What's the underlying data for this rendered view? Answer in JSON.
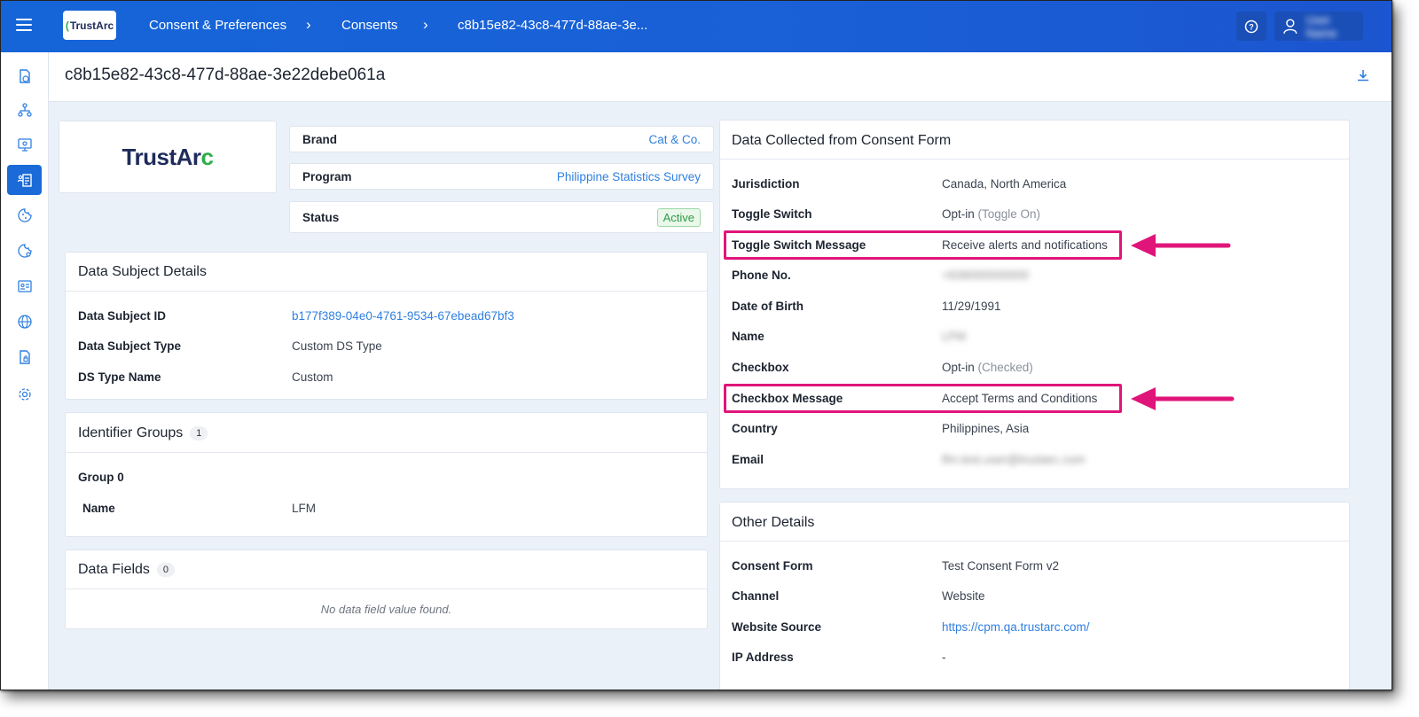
{
  "header": {
    "logo_text": "TrustArc",
    "breadcrumbs": [
      "Consent & Preferences",
      "Consents",
      "c8b15e82-43c8-477d-88ae-3e..."
    ],
    "user_name": "User Name"
  },
  "sidebar": {
    "items": [
      {
        "icon": "document-clock-icon",
        "active": false
      },
      {
        "icon": "network-icon",
        "active": false
      },
      {
        "icon": "monitor-icon",
        "active": false
      },
      {
        "icon": "consent-records-icon",
        "active": true
      },
      {
        "icon": "cookie-icon",
        "active": false
      },
      {
        "icon": "cookie-settings-icon",
        "active": false
      },
      {
        "icon": "id-card-icon",
        "active": false
      },
      {
        "icon": "globe-icon",
        "active": false
      },
      {
        "icon": "document-lock-icon",
        "active": false
      },
      {
        "icon": "gear-icon",
        "active": false
      }
    ]
  },
  "page": {
    "title": "c8b15e82-43c8-477d-88ae-3e22debe061a"
  },
  "brand_logo_text": {
    "part1": "TrustAr",
    "part2": "c"
  },
  "summary": {
    "brand_label": "Brand",
    "brand_value": "Cat & Co.",
    "program_label": "Program",
    "program_value": "Philippine Statistics Survey",
    "status_label": "Status",
    "status_value": "Active"
  },
  "data_subject": {
    "title": "Data Subject Details",
    "rows": [
      {
        "label": "Data Subject ID",
        "value": "b177f389-04e0-4761-9534-67ebead67bf3"
      },
      {
        "label": "Data Subject Type",
        "value": "Custom DS Type"
      },
      {
        "label": "DS Type Name",
        "value": "Custom"
      }
    ]
  },
  "identifier_groups": {
    "title": "Identifier Groups",
    "count": "1",
    "group_label": "Group 0",
    "name_label": "Name",
    "name_value": "LFM"
  },
  "data_fields": {
    "title": "Data Fields",
    "count": "0",
    "empty": "No data field value found."
  },
  "consent_form_data": {
    "title": "Data Collected from Consent Form",
    "rows": [
      {
        "label": "Jurisdiction",
        "value": "Canada, North America",
        "muted": ""
      },
      {
        "label": "Toggle Switch",
        "value": "Opt-in ",
        "muted": "(Toggle On)"
      },
      {
        "label": "Toggle Switch Message",
        "value": "Receive alerts and notifications",
        "muted": ""
      },
      {
        "label": "Phone No.",
        "value": "+639000000000",
        "muted": ""
      },
      {
        "label": "Date of Birth",
        "value": "11/29/1991",
        "muted": ""
      },
      {
        "label": "Name",
        "value": "LFM",
        "muted": ""
      },
      {
        "label": "Checkbox",
        "value": "Opt-in ",
        "muted": "(Checked)"
      },
      {
        "label": "Checkbox Message",
        "value": "Accept Terms and Conditions",
        "muted": ""
      },
      {
        "label": "Country",
        "value": "Philippines, Asia",
        "muted": ""
      },
      {
        "label": "Email",
        "value": "lfm.test.user@trustarc.com",
        "muted": ""
      }
    ]
  },
  "other_details": {
    "title": "Other Details",
    "rows": [
      {
        "label": "Consent Form",
        "value": "Test Consent Form v2"
      },
      {
        "label": "Channel",
        "value": "Website"
      },
      {
        "label": "Website Source",
        "value": "https://cpm.qa.trustarc.com/"
      },
      {
        "label": "IP Address",
        "value": "-"
      }
    ]
  },
  "colors": {
    "topbar": "#1a5fd6",
    "accent": "#1a6ad8",
    "link": "#2f7fe0",
    "highlight": "#e0157a",
    "active_badge": "#2f9a46"
  }
}
